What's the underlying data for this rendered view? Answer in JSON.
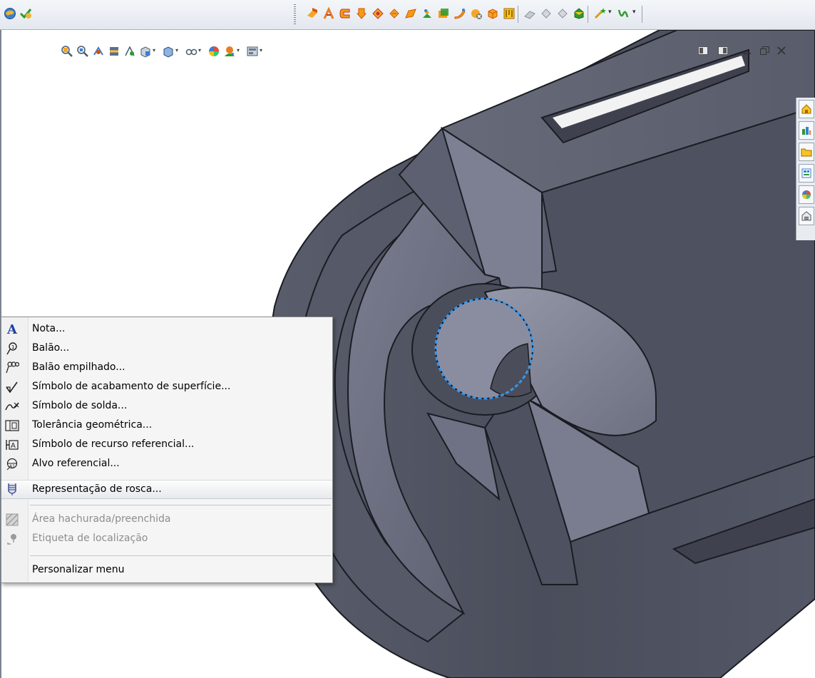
{
  "toolbar": {
    "left_icons": [
      "globe-options-icon",
      "rebuild-check-icon"
    ],
    "feature_icons": [
      "extrude-boss-icon",
      "revolve-icon",
      "sweep-icon",
      "loft-icon",
      "fillet-icon",
      "chamfer-icon",
      "rib-icon",
      "draft-icon",
      "shell-icon",
      "wrap-icon",
      "dome-icon",
      "intersect-icon",
      "hole-wizard-icon"
    ],
    "reference_icons": [
      "reference-plane-icon",
      "reference-axis-icon",
      "coordinate-system-icon",
      "point-icon"
    ],
    "extra_icons": [
      "curves-icon",
      "instant3d-icon"
    ]
  },
  "view_toolbar": {
    "icons": [
      "zoom-to-fit-icon",
      "zoom-area-icon",
      "previous-view-icon",
      "section-view-icon",
      "dynamic-annotation-icon",
      "view-orientation-icon",
      "display-style-icon",
      "hide-show-items-icon",
      "edit-appearance-icon",
      "apply-scene-icon",
      "view-settings-icon"
    ]
  },
  "window_controls": {
    "icons": [
      "tile-left-icon",
      "tile-right-icon",
      "minimize-icon",
      "restore-icon",
      "close-icon"
    ]
  },
  "task_pane": {
    "tabs": [
      "resources-home-icon",
      "design-library-icon",
      "file-explorer-icon",
      "view-palette-icon",
      "appearances-icon",
      "custom-properties-icon"
    ]
  },
  "context_menu": {
    "items": [
      {
        "label": "Nota...",
        "icon": "note-icon",
        "glyph": "A",
        "enabled": true
      },
      {
        "label": "Balão...",
        "icon": "balloon-icon",
        "glyph": "⚲",
        "enabled": true
      },
      {
        "label": "Balão empilhado...",
        "icon": "stacked-balloon-icon",
        "glyph": "ꝏ",
        "enabled": true
      },
      {
        "label": "Símbolo de acabamento de superfície...",
        "icon": "surface-finish-icon",
        "glyph": "√",
        "enabled": true
      },
      {
        "label": "Símbolo de solda...",
        "icon": "weld-symbol-icon",
        "glyph": "⌒",
        "enabled": true
      },
      {
        "label": "Tolerância geométrica...",
        "icon": "geometric-tolerance-icon",
        "glyph": "⊡",
        "enabled": true
      },
      {
        "label": "Símbolo de recurso referencial...",
        "icon": "datum-feature-icon",
        "glyph": "Ⓐ",
        "enabled": true
      },
      {
        "label": "Alvo referencial...",
        "icon": "datum-target-icon",
        "glyph": "⊘",
        "enabled": true
      },
      {
        "label": "Representação de rosca...",
        "icon": "cosmetic-thread-icon",
        "glyph": "Ʊ",
        "enabled": true,
        "highlighted": true
      },
      {
        "label": "Área hachurada/preenchida",
        "icon": "hatch-area-icon",
        "glyph": "▨",
        "enabled": false
      },
      {
        "label": "Etiqueta de localização",
        "icon": "location-label-icon",
        "glyph": "⚲",
        "enabled": false
      },
      {
        "label": "Personalizar menu",
        "icon": "",
        "glyph": "",
        "enabled": true
      }
    ]
  },
  "colors": {
    "model_face_dark": "#4b4f5c",
    "model_face_mid": "#6a6d7d",
    "model_face_light": "#8a8d9e",
    "selection_outline": "#3b95e8",
    "menu_background": "#f5f5f5"
  }
}
